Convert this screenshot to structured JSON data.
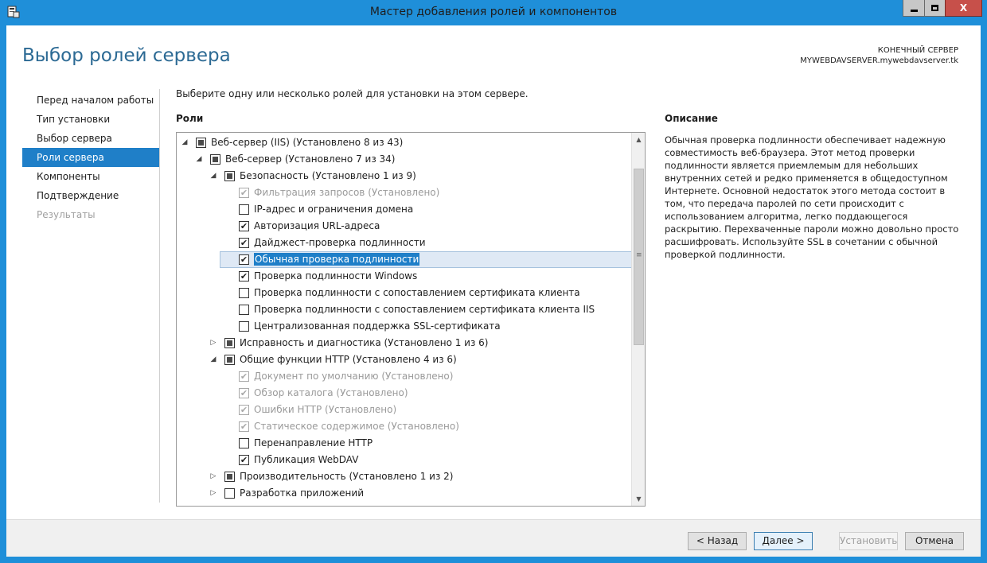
{
  "window": {
    "title": "Мастер добавления ролей и компонентов",
    "min_icon": "minimize-icon",
    "max_icon": "maximize-icon",
    "close_icon": "close-icon",
    "close_glyph": "X"
  },
  "header": {
    "page_title": "Выбор ролей сервера",
    "target_label": "КОНЕЧНЫЙ СЕРВЕР",
    "target_name": "MYWEBDAVSERVER.mywebdavserver.tk"
  },
  "nav": {
    "items": [
      {
        "label": "Перед началом работы",
        "state": "normal"
      },
      {
        "label": "Тип установки",
        "state": "normal"
      },
      {
        "label": "Выбор сервера",
        "state": "normal"
      },
      {
        "label": "Роли сервера",
        "state": "active"
      },
      {
        "label": "Компоненты",
        "state": "normal"
      },
      {
        "label": "Подтверждение",
        "state": "normal"
      },
      {
        "label": "Результаты",
        "state": "disabled"
      }
    ]
  },
  "main": {
    "instruction": "Выберите одну или несколько ролей для установки на этом сервере.",
    "roles_heading": "Роли",
    "tree": [
      {
        "label": "Веб-сервер (IIS) (Установлено 8 из 43)",
        "level": 0,
        "expander": "expanded",
        "check": "partial",
        "disabled": false
      },
      {
        "label": "Веб-сервер (Установлено 7 из 34)",
        "level": 1,
        "expander": "expanded",
        "check": "partial",
        "disabled": false
      },
      {
        "label": "Безопасность (Установлено 1 из 9)",
        "level": 2,
        "expander": "expanded",
        "check": "partial",
        "disabled": false
      },
      {
        "label": "Фильтрация запросов (Установлено)",
        "level": 3,
        "expander": "none",
        "check": "checked",
        "disabled": true
      },
      {
        "label": "IP-адрес и ограничения домена",
        "level": 3,
        "expander": "none",
        "check": "unchecked",
        "disabled": false
      },
      {
        "label": "Авторизация URL-адреса",
        "level": 3,
        "expander": "none",
        "check": "checked",
        "disabled": false
      },
      {
        "label": "Дайджест-проверка подлинности",
        "level": 3,
        "expander": "none",
        "check": "checked",
        "disabled": false
      },
      {
        "label": "Обычная проверка подлинности",
        "level": 3,
        "expander": "none",
        "check": "checked",
        "disabled": false,
        "selected": true
      },
      {
        "label": "Проверка подлинности Windows",
        "level": 3,
        "expander": "none",
        "check": "checked",
        "disabled": false
      },
      {
        "label": "Проверка подлинности с сопоставлением сертификата клиента",
        "level": 3,
        "expander": "none",
        "check": "unchecked",
        "disabled": false
      },
      {
        "label": "Проверка подлинности с сопоставлением сертификата клиента IIS",
        "level": 3,
        "expander": "none",
        "check": "unchecked",
        "disabled": false
      },
      {
        "label": "Централизованная поддержка SSL-сертификата",
        "level": 3,
        "expander": "none",
        "check": "unchecked",
        "disabled": false
      },
      {
        "label": "Исправность и диагностика (Установлено 1 из 6)",
        "level": 2,
        "expander": "collapsed",
        "check": "partial",
        "disabled": false
      },
      {
        "label": "Общие функции HTTP (Установлено 4 из 6)",
        "level": 2,
        "expander": "expanded",
        "check": "partial",
        "disabled": false
      },
      {
        "label": "Документ по умолчанию (Установлено)",
        "level": 3,
        "expander": "none",
        "check": "checked",
        "disabled": true
      },
      {
        "label": "Обзор каталога (Установлено)",
        "level": 3,
        "expander": "none",
        "check": "checked",
        "disabled": true
      },
      {
        "label": "Ошибки HTTP (Установлено)",
        "level": 3,
        "expander": "none",
        "check": "checked",
        "disabled": true
      },
      {
        "label": "Статическое содержимое (Установлено)",
        "level": 3,
        "expander": "none",
        "check": "checked",
        "disabled": true
      },
      {
        "label": "Перенаправление HTTP",
        "level": 3,
        "expander": "none",
        "check": "unchecked",
        "disabled": false
      },
      {
        "label": "Публикация WebDAV",
        "level": 3,
        "expander": "none",
        "check": "checked",
        "disabled": false
      },
      {
        "label": "Производительность (Установлено 1 из 2)",
        "level": 2,
        "expander": "collapsed",
        "check": "partial",
        "disabled": false
      },
      {
        "label": "Разработка приложений",
        "level": 2,
        "expander": "collapsed",
        "check": "unchecked",
        "disabled": false
      }
    ]
  },
  "description": {
    "heading": "Описание",
    "text": "Обычная проверка подлинности обеспечивает надежную совместимость веб-браузера. Этот метод проверки подлинности является приемлемым для небольших внутренних сетей и редко применяется в общедоступном Интернете. Основной недостаток этого метода состоит в том, что передача паролей по сети происходит с использованием алгоритма, легко поддающегося раскрытию. Перехваченные пароли можно довольно просто расшифровать. Используйте SSL в сочетании с обычной проверкой подлинности."
  },
  "footer": {
    "back_label": "< Назад",
    "next_label": "Далее >",
    "install_label": "Установить",
    "cancel_label": "Отмена"
  },
  "colors": {
    "accent": "#1f7fc8",
    "titlebar": "#1f8fd9",
    "title_text": "#2c6a94"
  }
}
